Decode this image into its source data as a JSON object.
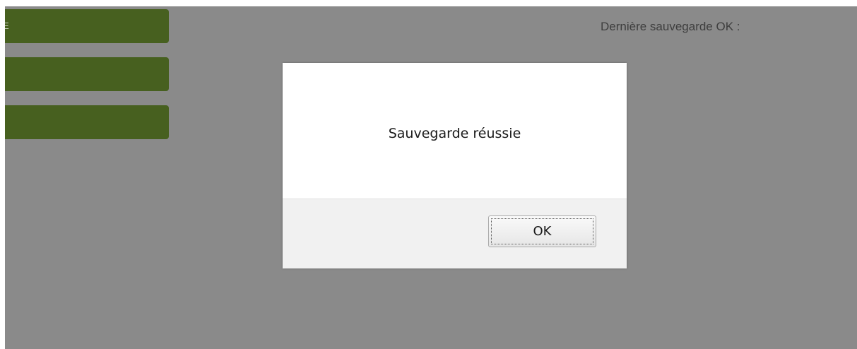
{
  "sidebar": {
    "buttons": [
      {
        "label": "E"
      },
      {
        "label": ""
      },
      {
        "label": ""
      }
    ]
  },
  "header": {
    "last_save_text": "Dernière sauvegarde OK :"
  },
  "dialog": {
    "message": "Sauvegarde réussie",
    "ok_label": "OK"
  },
  "colors": {
    "overlay": "#8a8a8a",
    "nav_button": "#47601f",
    "dialog_bg": "#ffffff",
    "dialog_footer": "#f1f1f1"
  }
}
